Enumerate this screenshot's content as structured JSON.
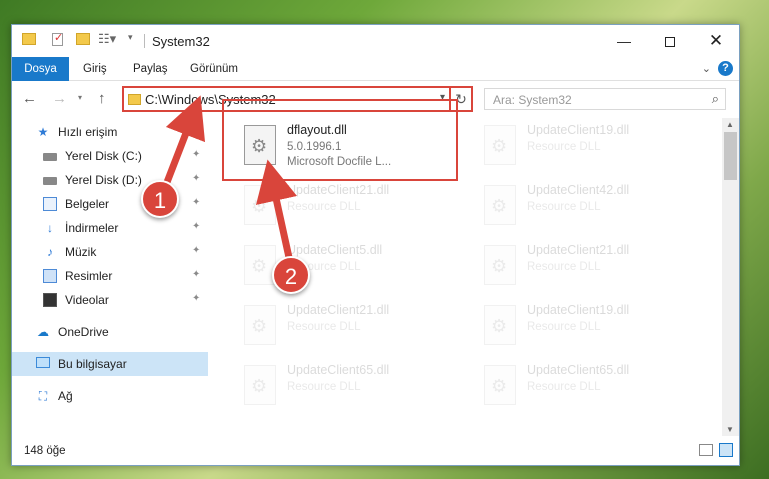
{
  "window": {
    "title": "System32",
    "controls": {
      "minimize": "—",
      "close": "✕"
    }
  },
  "quick_access": {
    "view_glyph": "☷▾",
    "customize_glyph": "▾"
  },
  "ribbon": {
    "tabs": [
      "Dosya",
      "Giriş",
      "Paylaş",
      "Görünüm"
    ],
    "active_tab": "Dosya",
    "help": "?"
  },
  "navigation": {
    "back": "←",
    "forward": "→",
    "recent": "▾",
    "up": "↑"
  },
  "address_bar": {
    "path": "C:\\Windows\\System32",
    "dropdown": "▾",
    "refresh": "↻"
  },
  "search": {
    "placeholder": "Ara: System32",
    "icon": "⌕"
  },
  "sidebar": {
    "items": [
      {
        "label": "Hızlı erişim",
        "icon": "star-icon",
        "glyph": "★",
        "pinned": false,
        "level": 0
      },
      {
        "label": "Yerel Disk (C:)",
        "icon": "drive-icon",
        "glyph": "",
        "pinned": true,
        "level": 1
      },
      {
        "label": "Yerel Disk (D:)",
        "icon": "drive-icon",
        "glyph": "",
        "pinned": true,
        "level": 1
      },
      {
        "label": "Belgeler",
        "icon": "documents-icon",
        "glyph": "",
        "pinned": true,
        "level": 1
      },
      {
        "label": "İndirmeler",
        "icon": "download-icon",
        "glyph": "↓",
        "pinned": true,
        "level": 1
      },
      {
        "label": "Müzik",
        "icon": "music-icon",
        "glyph": "♪",
        "pinned": true,
        "level": 1
      },
      {
        "label": "Resimler",
        "icon": "pictures-icon",
        "glyph": "",
        "pinned": true,
        "level": 1
      },
      {
        "label": "Videolar",
        "icon": "videos-icon",
        "glyph": "",
        "pinned": true,
        "level": 1
      },
      {
        "label": "OneDrive",
        "icon": "cloud-icon",
        "glyph": "☁",
        "pinned": false,
        "level": 0
      },
      {
        "label": "Bu bilgisayar",
        "icon": "computer-icon",
        "glyph": "",
        "pinned": false,
        "level": 0,
        "selected": true
      },
      {
        "label": "Ağ",
        "icon": "network-icon",
        "glyph": "⛶",
        "pinned": false,
        "level": 0
      }
    ],
    "pin_glyph": "📌"
  },
  "files": [
    {
      "name": "dflayout.dll",
      "version": "5.0.1996.1",
      "description": "Microsoft Docfile L...",
      "highlighted": true
    },
    {
      "name": "UpdateClient19.dll",
      "version": "Resource DLL",
      "description": "",
      "highlighted": false
    },
    {
      "name": "UpdateClient21.dll",
      "version": "Resource DLL",
      "description": "",
      "highlighted": false
    },
    {
      "name": "UpdateClient42.dll",
      "version": "Resource DLL",
      "description": "",
      "highlighted": false
    },
    {
      "name": "UpdateClient5.dll",
      "version": "Resource DLL",
      "description": "",
      "highlighted": false
    },
    {
      "name": "UpdateClient21.dll",
      "version": "Resource DLL",
      "description": "",
      "highlighted": false
    },
    {
      "name": "UpdateClient21.dll",
      "version": "Resource DLL",
      "description": "",
      "highlighted": false
    },
    {
      "name": "UpdateClient19.dll",
      "version": "Resource DLL",
      "description": "",
      "highlighted": false
    },
    {
      "name": "UpdateClient65.dll",
      "version": "Resource DLL",
      "description": "",
      "highlighted": false
    },
    {
      "name": "UpdateClient65.dll",
      "version": "Resource DLL",
      "description": "",
      "highlighted": false
    }
  ],
  "status_bar": {
    "item_count": "148 öğe"
  },
  "annotations": {
    "step_1": "1",
    "step_2": "2",
    "accent_color": "#d9453b"
  },
  "colors": {
    "ribbon_file_tab": "#1979ca",
    "selection": "#cce4f7"
  }
}
